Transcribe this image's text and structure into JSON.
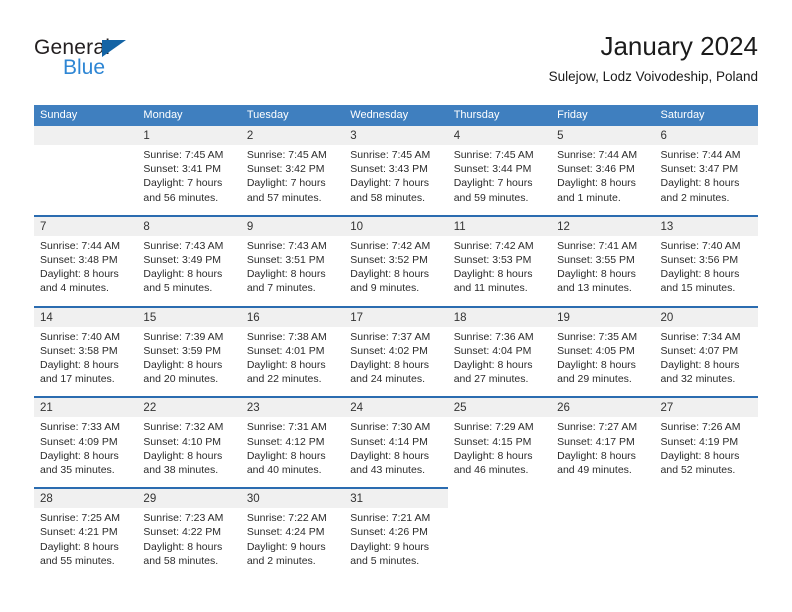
{
  "brand": {
    "name_part1": "General",
    "name_part2": "Blue",
    "triangle_icon": "triangle-icon",
    "accent_color": "#2e86d4"
  },
  "header": {
    "title": "January 2024",
    "subtitle": "Sulejow, Lodz Voivodeship, Poland"
  },
  "calendar": {
    "header_bg": "#3f7fbf",
    "row_divider_color": "#2b6cb0",
    "daynum_bg": "#f0f0f0",
    "weekdays": [
      "Sunday",
      "Monday",
      "Tuesday",
      "Wednesday",
      "Thursday",
      "Friday",
      "Saturday"
    ],
    "weeks": [
      [
        {
          "day": "",
          "sunrise": "",
          "sunset": "",
          "daylight1": "",
          "daylight2": ""
        },
        {
          "day": "1",
          "sunrise": "Sunrise: 7:45 AM",
          "sunset": "Sunset: 3:41 PM",
          "daylight1": "Daylight: 7 hours",
          "daylight2": "and 56 minutes."
        },
        {
          "day": "2",
          "sunrise": "Sunrise: 7:45 AM",
          "sunset": "Sunset: 3:42 PM",
          "daylight1": "Daylight: 7 hours",
          "daylight2": "and 57 minutes."
        },
        {
          "day": "3",
          "sunrise": "Sunrise: 7:45 AM",
          "sunset": "Sunset: 3:43 PM",
          "daylight1": "Daylight: 7 hours",
          "daylight2": "and 58 minutes."
        },
        {
          "day": "4",
          "sunrise": "Sunrise: 7:45 AM",
          "sunset": "Sunset: 3:44 PM",
          "daylight1": "Daylight: 7 hours",
          "daylight2": "and 59 minutes."
        },
        {
          "day": "5",
          "sunrise": "Sunrise: 7:44 AM",
          "sunset": "Sunset: 3:46 PM",
          "daylight1": "Daylight: 8 hours",
          "daylight2": "and 1 minute."
        },
        {
          "day": "6",
          "sunrise": "Sunrise: 7:44 AM",
          "sunset": "Sunset: 3:47 PM",
          "daylight1": "Daylight: 8 hours",
          "daylight2": "and 2 minutes."
        }
      ],
      [
        {
          "day": "7",
          "sunrise": "Sunrise: 7:44 AM",
          "sunset": "Sunset: 3:48 PM",
          "daylight1": "Daylight: 8 hours",
          "daylight2": "and 4 minutes."
        },
        {
          "day": "8",
          "sunrise": "Sunrise: 7:43 AM",
          "sunset": "Sunset: 3:49 PM",
          "daylight1": "Daylight: 8 hours",
          "daylight2": "and 5 minutes."
        },
        {
          "day": "9",
          "sunrise": "Sunrise: 7:43 AM",
          "sunset": "Sunset: 3:51 PM",
          "daylight1": "Daylight: 8 hours",
          "daylight2": "and 7 minutes."
        },
        {
          "day": "10",
          "sunrise": "Sunrise: 7:42 AM",
          "sunset": "Sunset: 3:52 PM",
          "daylight1": "Daylight: 8 hours",
          "daylight2": "and 9 minutes."
        },
        {
          "day": "11",
          "sunrise": "Sunrise: 7:42 AM",
          "sunset": "Sunset: 3:53 PM",
          "daylight1": "Daylight: 8 hours",
          "daylight2": "and 11 minutes."
        },
        {
          "day": "12",
          "sunrise": "Sunrise: 7:41 AM",
          "sunset": "Sunset: 3:55 PM",
          "daylight1": "Daylight: 8 hours",
          "daylight2": "and 13 minutes."
        },
        {
          "day": "13",
          "sunrise": "Sunrise: 7:40 AM",
          "sunset": "Sunset: 3:56 PM",
          "daylight1": "Daylight: 8 hours",
          "daylight2": "and 15 minutes."
        }
      ],
      [
        {
          "day": "14",
          "sunrise": "Sunrise: 7:40 AM",
          "sunset": "Sunset: 3:58 PM",
          "daylight1": "Daylight: 8 hours",
          "daylight2": "and 17 minutes."
        },
        {
          "day": "15",
          "sunrise": "Sunrise: 7:39 AM",
          "sunset": "Sunset: 3:59 PM",
          "daylight1": "Daylight: 8 hours",
          "daylight2": "and 20 minutes."
        },
        {
          "day": "16",
          "sunrise": "Sunrise: 7:38 AM",
          "sunset": "Sunset: 4:01 PM",
          "daylight1": "Daylight: 8 hours",
          "daylight2": "and 22 minutes."
        },
        {
          "day": "17",
          "sunrise": "Sunrise: 7:37 AM",
          "sunset": "Sunset: 4:02 PM",
          "daylight1": "Daylight: 8 hours",
          "daylight2": "and 24 minutes."
        },
        {
          "day": "18",
          "sunrise": "Sunrise: 7:36 AM",
          "sunset": "Sunset: 4:04 PM",
          "daylight1": "Daylight: 8 hours",
          "daylight2": "and 27 minutes."
        },
        {
          "day": "19",
          "sunrise": "Sunrise: 7:35 AM",
          "sunset": "Sunset: 4:05 PM",
          "daylight1": "Daylight: 8 hours",
          "daylight2": "and 29 minutes."
        },
        {
          "day": "20",
          "sunrise": "Sunrise: 7:34 AM",
          "sunset": "Sunset: 4:07 PM",
          "daylight1": "Daylight: 8 hours",
          "daylight2": "and 32 minutes."
        }
      ],
      [
        {
          "day": "21",
          "sunrise": "Sunrise: 7:33 AM",
          "sunset": "Sunset: 4:09 PM",
          "daylight1": "Daylight: 8 hours",
          "daylight2": "and 35 minutes."
        },
        {
          "day": "22",
          "sunrise": "Sunrise: 7:32 AM",
          "sunset": "Sunset: 4:10 PM",
          "daylight1": "Daylight: 8 hours",
          "daylight2": "and 38 minutes."
        },
        {
          "day": "23",
          "sunrise": "Sunrise: 7:31 AM",
          "sunset": "Sunset: 4:12 PM",
          "daylight1": "Daylight: 8 hours",
          "daylight2": "and 40 minutes."
        },
        {
          "day": "24",
          "sunrise": "Sunrise: 7:30 AM",
          "sunset": "Sunset: 4:14 PM",
          "daylight1": "Daylight: 8 hours",
          "daylight2": "and 43 minutes."
        },
        {
          "day": "25",
          "sunrise": "Sunrise: 7:29 AM",
          "sunset": "Sunset: 4:15 PM",
          "daylight1": "Daylight: 8 hours",
          "daylight2": "and 46 minutes."
        },
        {
          "day": "26",
          "sunrise": "Sunrise: 7:27 AM",
          "sunset": "Sunset: 4:17 PM",
          "daylight1": "Daylight: 8 hours",
          "daylight2": "and 49 minutes."
        },
        {
          "day": "27",
          "sunrise": "Sunrise: 7:26 AM",
          "sunset": "Sunset: 4:19 PM",
          "daylight1": "Daylight: 8 hours",
          "daylight2": "and 52 minutes."
        }
      ],
      [
        {
          "day": "28",
          "sunrise": "Sunrise: 7:25 AM",
          "sunset": "Sunset: 4:21 PM",
          "daylight1": "Daylight: 8 hours",
          "daylight2": "and 55 minutes."
        },
        {
          "day": "29",
          "sunrise": "Sunrise: 7:23 AM",
          "sunset": "Sunset: 4:22 PM",
          "daylight1": "Daylight: 8 hours",
          "daylight2": "and 58 minutes."
        },
        {
          "day": "30",
          "sunrise": "Sunrise: 7:22 AM",
          "sunset": "Sunset: 4:24 PM",
          "daylight1": "Daylight: 9 hours",
          "daylight2": "and 2 minutes."
        },
        {
          "day": "31",
          "sunrise": "Sunrise: 7:21 AM",
          "sunset": "Sunset: 4:26 PM",
          "daylight1": "Daylight: 9 hours",
          "daylight2": "and 5 minutes."
        },
        {
          "day": "",
          "sunrise": "",
          "sunset": "",
          "daylight1": "",
          "daylight2": ""
        },
        {
          "day": "",
          "sunrise": "",
          "sunset": "",
          "daylight1": "",
          "daylight2": ""
        },
        {
          "day": "",
          "sunrise": "",
          "sunset": "",
          "daylight1": "",
          "daylight2": ""
        }
      ]
    ]
  }
}
